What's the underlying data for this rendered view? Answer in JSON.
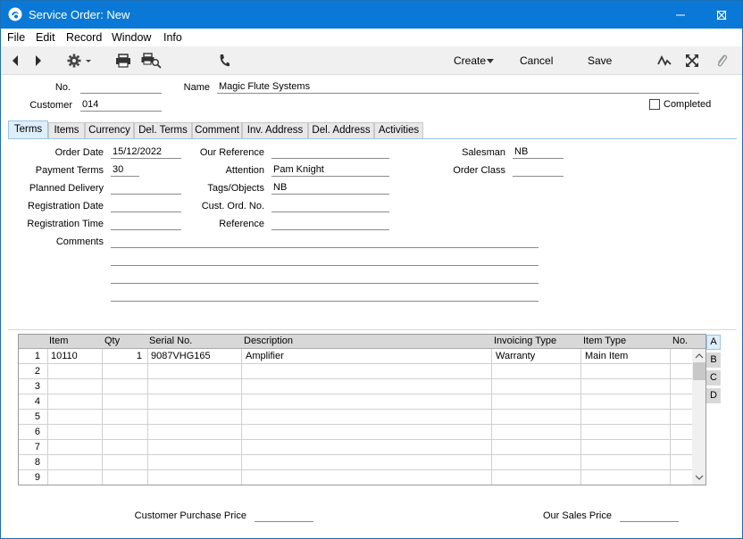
{
  "window": {
    "title": "Service Order: New"
  },
  "menu": [
    "File",
    "Edit",
    "Record",
    "Window",
    "Info"
  ],
  "toolbar": {
    "create_label": "Create",
    "cancel_label": "Cancel",
    "save_label": "Save"
  },
  "header": {
    "no_label": "No.",
    "no_value": "",
    "name_label": "Name",
    "name_value": "Magic Flute Systems",
    "customer_label": "Customer",
    "customer_value": "014",
    "completed_label": "Completed",
    "completed_checked": false
  },
  "tabs": [
    {
      "label": "Terms",
      "active": true
    },
    {
      "label": "Items",
      "active": false
    },
    {
      "label": "Currency",
      "active": false
    },
    {
      "label": "Del. Terms",
      "active": false
    },
    {
      "label": "Comment",
      "active": false
    },
    {
      "label": "Inv. Address",
      "active": false
    },
    {
      "label": "Del. Address",
      "active": false
    },
    {
      "label": "Activities",
      "active": false
    }
  ],
  "terms": {
    "order_date_label": "Order Date",
    "order_date": "15/12/2022",
    "payment_terms_label": "Payment Terms",
    "payment_terms": "30",
    "planned_delivery_label": "Planned Delivery",
    "planned_delivery": "",
    "registration_date_label": "Registration Date",
    "registration_date": "",
    "registration_time_label": "Registration Time",
    "registration_time": "",
    "comments_label": "Comments",
    "our_reference_label": "Our Reference",
    "our_reference": "",
    "attention_label": "Attention",
    "attention": "Pam Knight",
    "tags_label": "Tags/Objects",
    "tags": "NB",
    "cust_ord_no_label": "Cust. Ord. No.",
    "cust_ord_no": "",
    "reference_label": "Reference",
    "reference": "",
    "salesman_label": "Salesman",
    "salesman": "NB",
    "order_class_label": "Order Class",
    "order_class": ""
  },
  "grid": {
    "columns": [
      "Item",
      "Qty",
      "Serial No.",
      "Description",
      "Invoicing Type",
      "Item Type",
      "No."
    ],
    "rows": [
      {
        "num": "1",
        "item": "10110",
        "qty": "1",
        "serial": "9087VHG165",
        "description": "Amplifier",
        "invoicing_type": "Warranty",
        "item_type": "Main Item",
        "no": ""
      },
      {
        "num": "2",
        "item": "",
        "qty": "",
        "serial": "",
        "description": "",
        "invoicing_type": "",
        "item_type": "",
        "no": ""
      },
      {
        "num": "3",
        "item": "",
        "qty": "",
        "serial": "",
        "description": "",
        "invoicing_type": "",
        "item_type": "",
        "no": ""
      },
      {
        "num": "4",
        "item": "",
        "qty": "",
        "serial": "",
        "description": "",
        "invoicing_type": "",
        "item_type": "",
        "no": ""
      },
      {
        "num": "5",
        "item": "",
        "qty": "",
        "serial": "",
        "description": "",
        "invoicing_type": "",
        "item_type": "",
        "no": ""
      },
      {
        "num": "6",
        "item": "",
        "qty": "",
        "serial": "",
        "description": "",
        "invoicing_type": "",
        "item_type": "",
        "no": ""
      },
      {
        "num": "7",
        "item": "",
        "qty": "",
        "serial": "",
        "description": "",
        "invoicing_type": "",
        "item_type": "",
        "no": ""
      },
      {
        "num": "8",
        "item": "",
        "qty": "",
        "serial": "",
        "description": "",
        "invoicing_type": "",
        "item_type": "",
        "no": ""
      },
      {
        "num": "9",
        "item": "",
        "qty": "",
        "serial": "",
        "description": "",
        "invoicing_type": "",
        "item_type": "",
        "no": ""
      }
    ],
    "side_tabs": [
      "A",
      "B",
      "C",
      "D"
    ]
  },
  "footer": {
    "customer_purchase_price_label": "Customer Purchase Price",
    "customer_purchase_price": "",
    "our_sales_price_label": "Our Sales Price",
    "our_sales_price": ""
  }
}
